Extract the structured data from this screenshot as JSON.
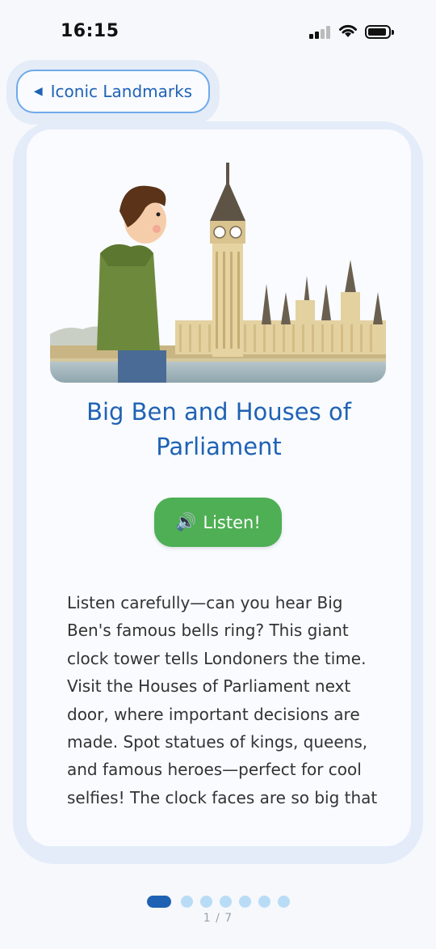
{
  "status_bar": {
    "time": "16:15",
    "icons": [
      "signal-icon",
      "wifi-icon",
      "battery-icon"
    ]
  },
  "header": {
    "back_icon": "◀",
    "back_label": "Iconic Landmarks"
  },
  "card": {
    "image_description_icon": "big-ben-illustration",
    "title": "Big Ben and Houses of Parliament",
    "listen_icon": "🔊",
    "listen_label": "Listen!",
    "body": "Listen carefully—can you hear Big Ben's famous bells ring? This giant clock tower tells Londoners the time. Visit the Houses of Parliament next door, where important decisions are made. Spot statues of kings, queens, and famous heroes—perfect for cool selfies! The clock faces are so big that you could fit a double-decker bus"
  },
  "pagination": {
    "total": 7,
    "current": 1,
    "indicator": "1 / 7"
  },
  "colors": {
    "accent": "#1f62b4",
    "listen_button": "#4eaf54",
    "dot_inactive": "#b9dcf6",
    "background": "#f6f8fc"
  }
}
